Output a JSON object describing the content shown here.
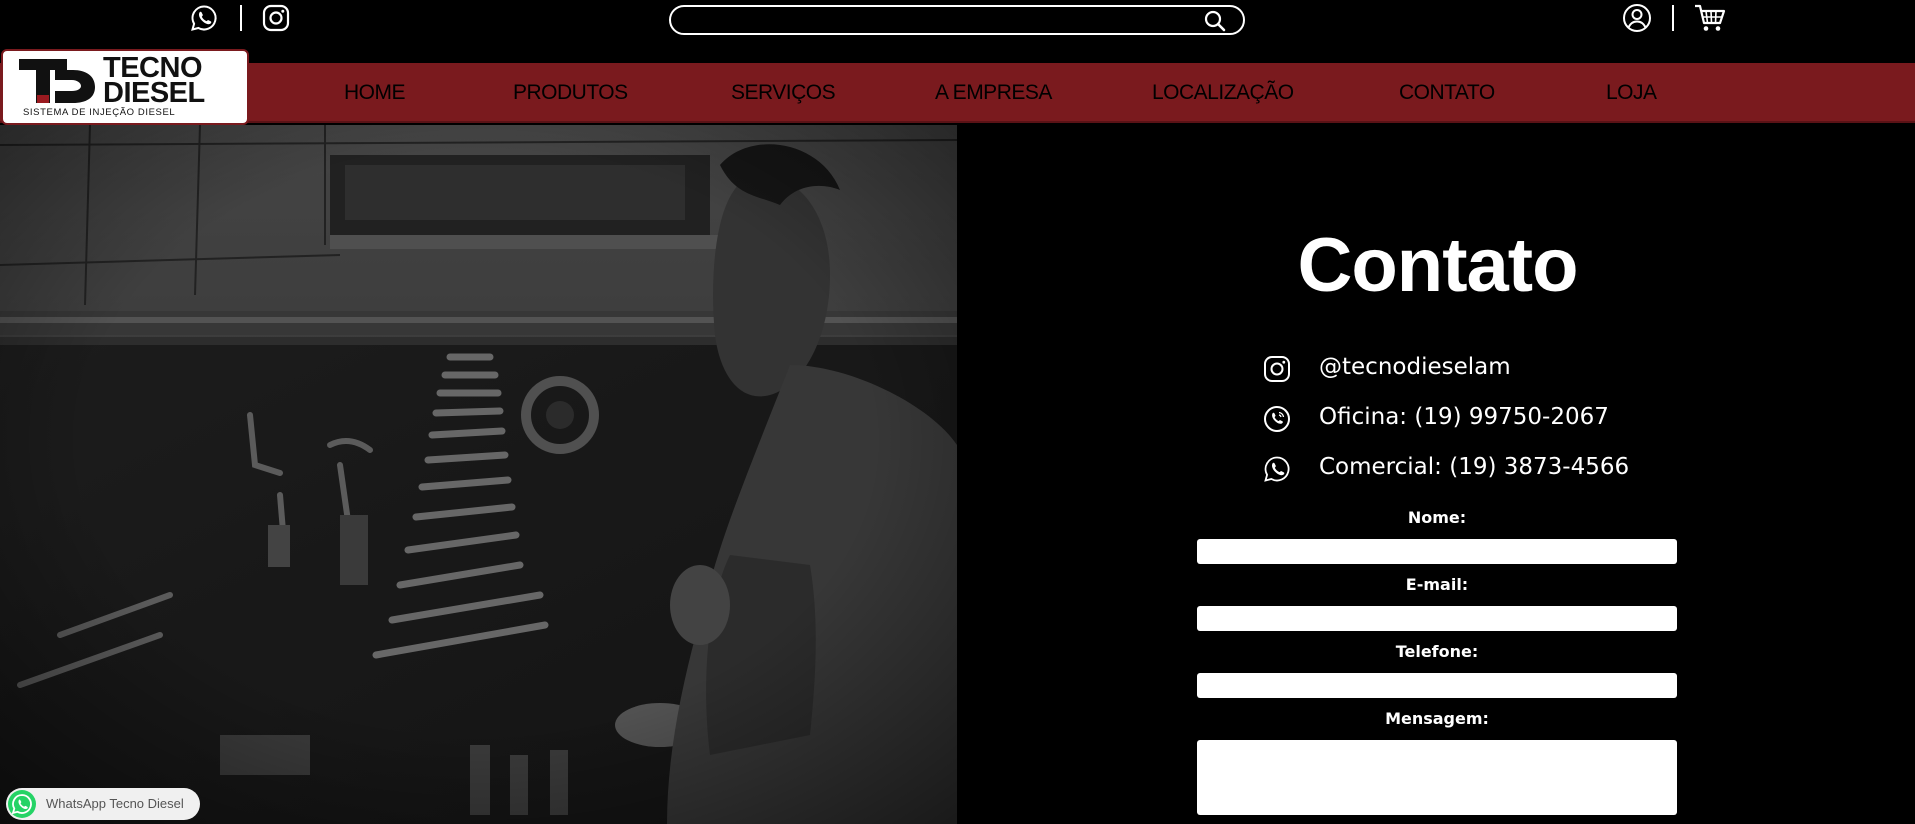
{
  "header": {
    "search": {
      "placeholder": "",
      "value": ""
    },
    "icons": [
      "whatsapp-icon",
      "instagram-icon",
      "search-icon",
      "user-icon",
      "cart-icon"
    ]
  },
  "logo": {
    "line1": "TECNO",
    "line2": "DIESEL",
    "tagline": "SISTEMA DE INJEÇÃO DIESEL"
  },
  "nav": {
    "items": [
      {
        "label": "HOME"
      },
      {
        "label": "PRODUTOS"
      },
      {
        "label": "SERVIÇOS"
      },
      {
        "label": "A EMPRESA"
      },
      {
        "label": "LOCALIZAÇÃO"
      },
      {
        "label": "CONTATO"
      },
      {
        "label": "LOJA"
      }
    ]
  },
  "contact": {
    "title": "Contato",
    "instagram": "@tecnodieselam",
    "oficina": "Oficina: (19) 99750-2067",
    "comercial": "Comercial: (19) 3873-4566"
  },
  "form": {
    "nome_label": "Nome:",
    "email_label": "E-mail:",
    "telefone_label": "Telefone:",
    "mensagem_label": "Mensagem:",
    "nome_value": "",
    "email_value": "",
    "telefone_value": "",
    "mensagem_value": ""
  },
  "whatsapp_badge": {
    "label": "WhatsApp Tecno Diesel"
  },
  "colors": {
    "nav_bg": "#7a1a1e",
    "page_bg": "#000000",
    "whatsapp_green": "#25d366"
  }
}
